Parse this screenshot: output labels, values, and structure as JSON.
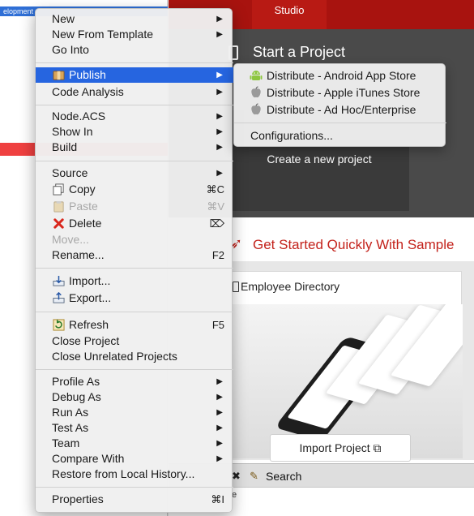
{
  "explorer": {
    "selected_fragment": "elopment"
  },
  "dashboard": {
    "top_tab": "Studio",
    "start_title": "Start a Project",
    "new_project_label": "Create a new project",
    "get_started": "Get Started Quickly With Sample",
    "sample_title": "Employee Directory",
    "import_button": "Import Project",
    "search_tab": "Search",
    "bottom_fragment": "e"
  },
  "menu": {
    "new": "New",
    "new_from_template": "New From Template",
    "go_into": "Go Into",
    "publish": "Publish",
    "code_analysis": "Code Analysis",
    "node_acs": "Node.ACS",
    "show_in": "Show In",
    "build": "Build",
    "source": "Source",
    "copy": "Copy",
    "copy_shortcut": "⌘C",
    "paste": "Paste",
    "paste_shortcut": "⌘V",
    "delete": "Delete",
    "delete_shortcut": "⌦",
    "move": "Move...",
    "rename": "Rename...",
    "rename_shortcut": "F2",
    "import": "Import...",
    "export": "Export...",
    "refresh": "Refresh",
    "refresh_shortcut": "F5",
    "close_project": "Close Project",
    "close_unrelated": "Close Unrelated Projects",
    "profile_as": "Profile As",
    "debug_as": "Debug As",
    "run_as": "Run As",
    "test_as": "Test As",
    "team": "Team",
    "compare_with": "Compare With",
    "restore_history": "Restore from Local History...",
    "properties": "Properties",
    "properties_shortcut": "⌘I"
  },
  "submenu": {
    "android": "Distribute - Android App Store",
    "apple": "Distribute - Apple iTunes Store",
    "adhoc": "Distribute - Ad Hoc/Enterprise",
    "configurations": "Configurations..."
  },
  "colors": {
    "highlight": "#2665e0",
    "brand_red": "#a8130f",
    "delete_red": "#d9261c",
    "android_green": "#8dc63f"
  }
}
